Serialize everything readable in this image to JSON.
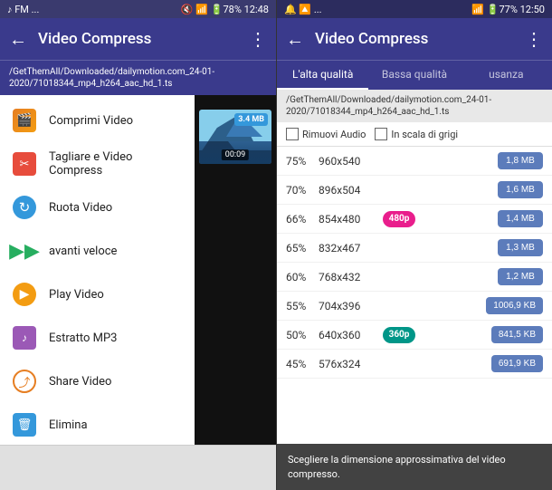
{
  "left": {
    "status_bar": {
      "left": "♪ FM ...",
      "right": "🔇 📶 🔋78% 12:48"
    },
    "top_bar": {
      "title": "Video Compress",
      "back": "←",
      "more": "⋮"
    },
    "path": "/GetThemAll/Downloaded/dailymotion.com_24-01-2020/71018344_mp4_h264_aac_hd_1.ts",
    "menu_items": [
      {
        "id": "comprimi",
        "label": "Comprimi Video",
        "icon": "compress"
      },
      {
        "id": "tagliare",
        "label": "Tagliare e Video Compress",
        "icon": "tagliare"
      },
      {
        "id": "ruota",
        "label": "Ruota Video",
        "icon": "ruota"
      },
      {
        "id": "avanti",
        "label": "avanti veloce",
        "icon": "avanti"
      },
      {
        "id": "play",
        "label": "Play Video",
        "icon": "play"
      },
      {
        "id": "estratto",
        "label": "Estratto MP3",
        "icon": "estratto"
      },
      {
        "id": "share",
        "label": "Share Video",
        "icon": "share"
      },
      {
        "id": "elimina",
        "label": "Elimina",
        "icon": "elimina"
      }
    ],
    "thumbnail": {
      "size_badge": "3.4 MB",
      "time_badge": "00:09"
    }
  },
  "right": {
    "status_bar": {
      "left": "🔔 🔼 ...",
      "right": "📶 🔋77% 12:50"
    },
    "top_bar": {
      "title": "Video Compress",
      "back": "←",
      "more": "⋮"
    },
    "tabs": [
      {
        "id": "alta",
        "label": "L'alta qualità",
        "active": true
      },
      {
        "id": "bassa",
        "label": "Bassa qualità",
        "active": false
      },
      {
        "id": "usanza",
        "label": "usanza",
        "active": false
      }
    ],
    "path": "/GetThemAll/Downloaded/dailymotion.com_24-01-2020/71018344_mp4_h264_aac_hd_1.ts",
    "options": {
      "remove_audio_label": "Rimuovi Audio",
      "grayscale_label": "In scala di grigi"
    },
    "quality_rows": [
      {
        "pct": "75%",
        "res": "960x540",
        "badge": null,
        "size": "1,8 MB"
      },
      {
        "pct": "70%",
        "res": "896x504",
        "badge": null,
        "size": "1,6 MB"
      },
      {
        "pct": "66%",
        "res": "854x480",
        "badge": "480p",
        "badge_color": "pink",
        "size": "1,4 MB"
      },
      {
        "pct": "65%",
        "res": "832x467",
        "badge": null,
        "size": "1,3 MB"
      },
      {
        "pct": "60%",
        "res": "768x432",
        "badge": null,
        "size": "1,2 MB"
      },
      {
        "pct": "55%",
        "res": "704x396",
        "badge": null,
        "size": "1006,9 KB"
      },
      {
        "pct": "50%",
        "res": "640x360",
        "badge": "360p",
        "badge_color": "teal",
        "size": "841,5 KB"
      },
      {
        "pct": "45%",
        "res": "576x324",
        "badge": null,
        "size": "691,9 KB"
      }
    ],
    "tooltip": "Scegliere la dimensione approssimativa del video compresso."
  }
}
